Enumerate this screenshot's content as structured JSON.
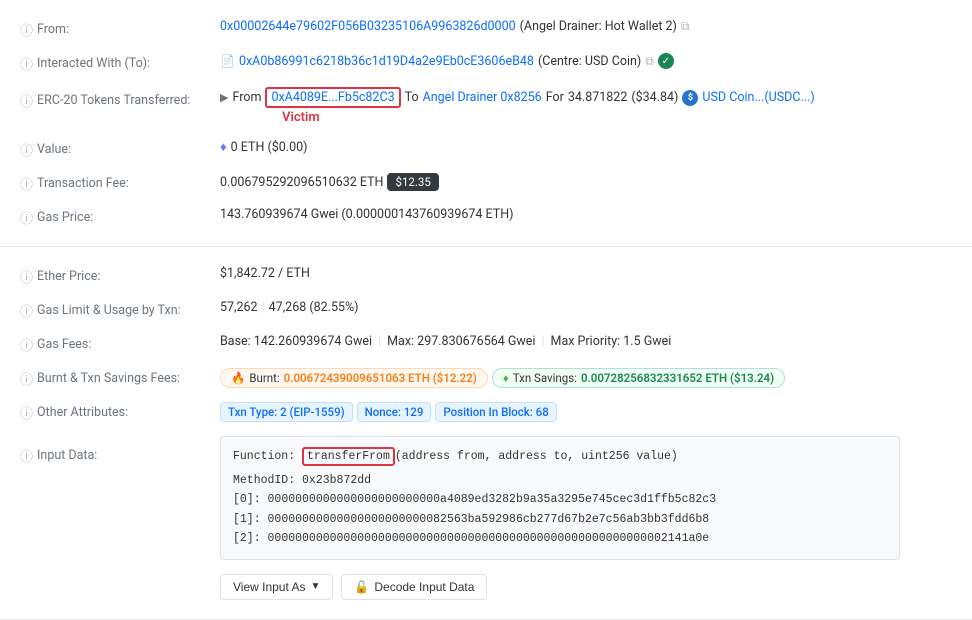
{
  "fields": {
    "from": {
      "label": "From:",
      "address": "0x00002644e79602F056B03235106A9963826d0000",
      "alias": "(Angel Drainer: Hot Wallet 2)"
    },
    "interacted_with": {
      "label": "Interacted With (To):",
      "address": "0xA0b86991c6218b36c1d19D4a2e9Eb0cE3606eB48",
      "alias": "(Centre: USD Coin)"
    },
    "erc20": {
      "label": "ERC-20 Tokens Transferred:",
      "from_prefix": "From",
      "from_address": "0xA4089E...Fb5c82C3",
      "to_text": "To",
      "to_address": "Angel Drainer 0x8256",
      "for_text": "For",
      "amount": "34.871822",
      "amount_usd": "($34.84)",
      "token_name": "USD Coin...(USDC...)",
      "victim_label": "Victim"
    },
    "value": {
      "label": "Value:",
      "amount": "0 ETH ($0.00)"
    },
    "transaction_fee": {
      "label": "Transaction Fee:",
      "amount": "0.006795292096510632 ETH",
      "badge": "$12.35"
    },
    "gas_price": {
      "label": "Gas Price:",
      "value": "143.760939674 Gwei (0.000000143760939674 ETH)"
    },
    "ether_price": {
      "label": "Ether Price:",
      "value": "$1,842.72 / ETH"
    },
    "gas_limit": {
      "label": "Gas Limit & Usage by Txn:",
      "limit": "57,262",
      "usage": "47,268 (82.55%)"
    },
    "gas_fees": {
      "label": "Gas Fees:",
      "base": "Base: 142.260939674 Gwei",
      "max": "Max: 297.830676564 Gwei",
      "max_priority": "Max Priority: 1.5 Gwei"
    },
    "burnt_savings": {
      "label": "Burnt & Txn Savings Fees:",
      "burnt_label": "Burnt:",
      "burnt_value": "0.00672439009651063 ETH ($12.22)",
      "savings_label": "Txn Savings:",
      "savings_value": "0.00728256832331652 ETH ($13.24)"
    },
    "other_attributes": {
      "label": "Other Attributes:",
      "txn_type": "Txn Type: 2 (EIP-1559)",
      "nonce": "Nonce: 129",
      "position": "Position In Block: 68"
    },
    "input_data": {
      "label": "Input Data:",
      "function_text": "Function:",
      "function_name": "transferFrom",
      "function_params": "(address from, address to, uint256 value)",
      "method_id_label": "MethodID:",
      "method_id": "0x23b872dd",
      "params": [
        {
          "index": "[0]:",
          "value": "0000000000000000000000000a4089ed3282b9a35a3295e745cec3d1ffb5c82c3"
        },
        {
          "index": "[1]:",
          "value": "00000000000000000000000082563ba592986cb277d67b2e7c56ab3bb3fdd6b8"
        },
        {
          "index": "[2]:",
          "value": "0000000000000000000000000000000000000000000000000000000002141a0e"
        }
      ],
      "view_input_label": "View Input As",
      "decode_label": "Decode Input Data"
    }
  }
}
